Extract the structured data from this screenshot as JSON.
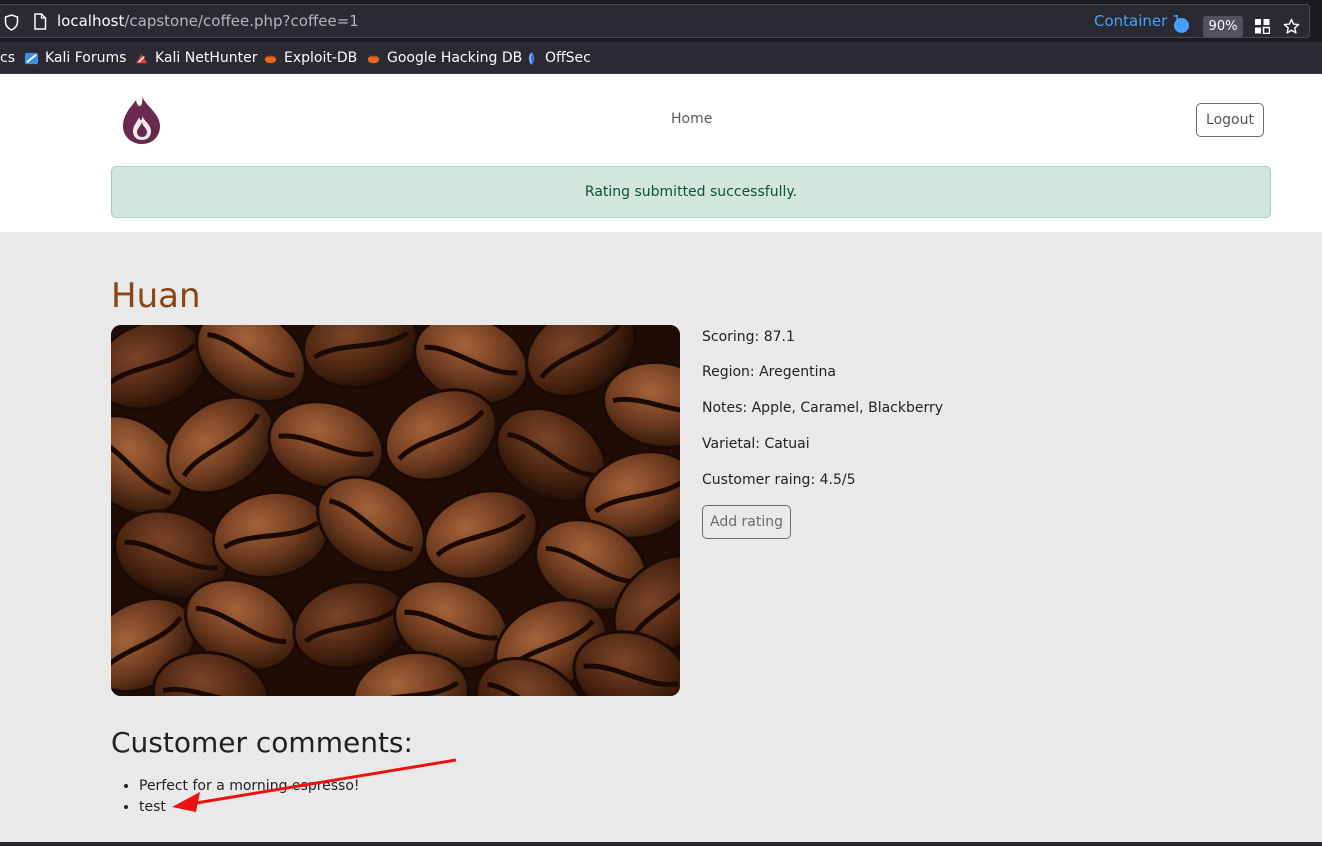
{
  "browser": {
    "url_host": "localhost",
    "url_path": "/capstone/coffee.php?coffee=1",
    "container_label": "Container 1",
    "container_color": "#45a1ff",
    "zoom": "90%",
    "bookmarks": [
      {
        "label": "cs",
        "icon": "none"
      },
      {
        "label": "Kali Forums",
        "icon": "kali-forums-icon"
      },
      {
        "label": "Kali NetHunter",
        "icon": "nethunter-icon"
      },
      {
        "label": "Exploit-DB",
        "icon": "exploitdb-icon"
      },
      {
        "label": "Google Hacking DB",
        "icon": "ghdb-icon"
      },
      {
        "label": "OffSec",
        "icon": "offsec-icon"
      }
    ]
  },
  "header": {
    "logo": "flame-logo-icon",
    "nav_home": "Home",
    "logout_label": "Logout"
  },
  "alert": {
    "message": "Rating submitted successfully.",
    "color": "#d1e7dd"
  },
  "coffee": {
    "name": "Huan",
    "name_color": "#8b4513",
    "image": "coffee-beans-photo",
    "details": [
      "Scoring: 87.1",
      "Region: Aregentina",
      "Notes: Apple, Caramel, Blackberry",
      "Varietal: Catuai",
      "Customer raing: 4.5/5"
    ],
    "add_rating_label": "Add rating"
  },
  "comments": {
    "heading": "Customer comments:",
    "items": [
      "Perfect for a morning espresso!",
      "test"
    ]
  },
  "annotation": {
    "arrow_color": "#ee1111"
  }
}
